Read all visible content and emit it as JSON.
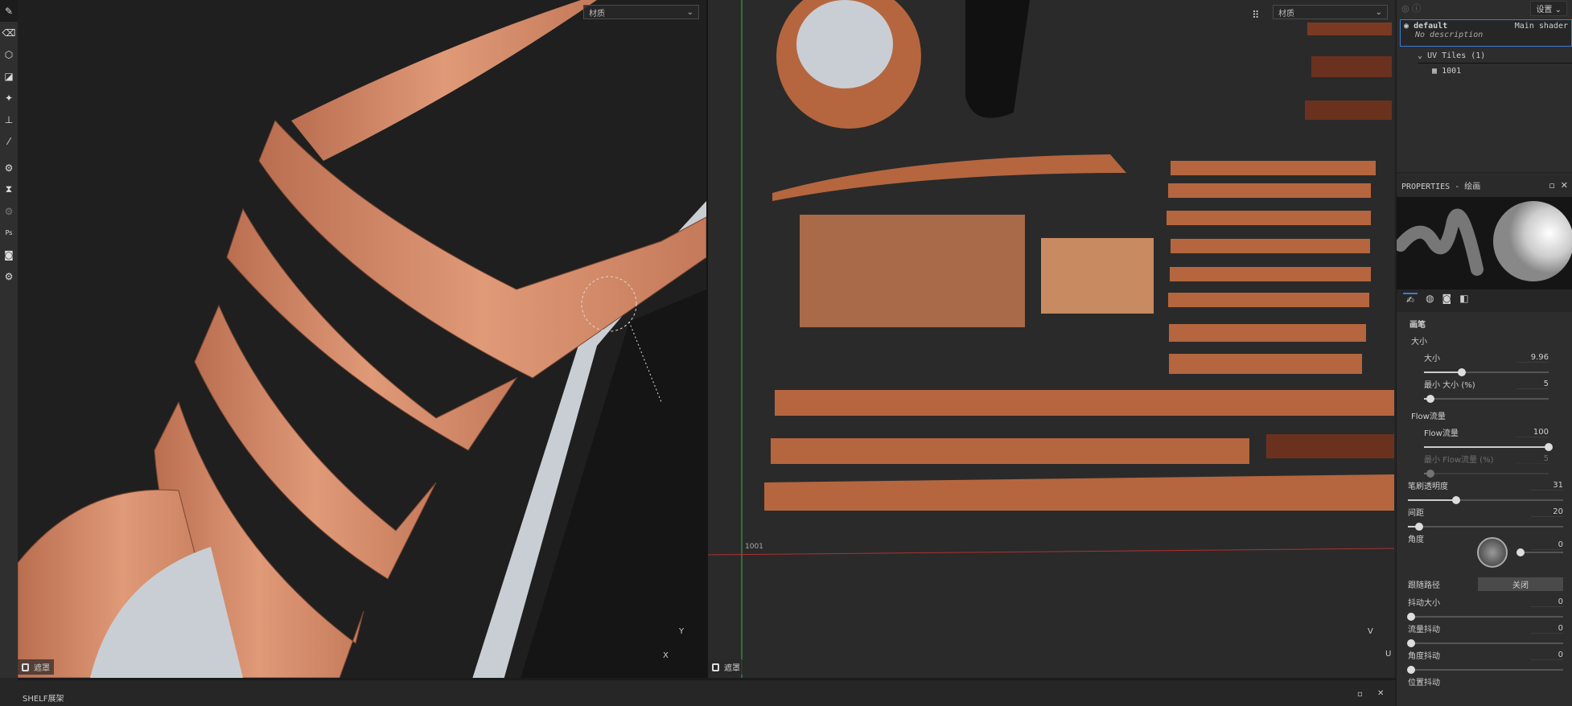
{
  "toolbar": {
    "tools": [
      "brush-icon",
      "eraser-icon",
      "projection-icon",
      "polygon-fill-icon",
      "smudge-icon",
      "clone-stamp-icon",
      "color-picker-icon",
      "plugin-icon",
      "hourglass-icon",
      "plugin2-icon",
      "photoshop-icon",
      "export-icon",
      "settings-icon"
    ]
  },
  "viewport3d": {
    "select_value": "材质",
    "mask_label": "遮罩",
    "axes": {
      "y": "Y",
      "x": "X"
    }
  },
  "viewportUV": {
    "select_value": "材质",
    "mask_label": "遮罩",
    "tile_label": "1001",
    "axes": {
      "v": "V",
      "u": "U"
    }
  },
  "shelf": {
    "title": "SHELF展架"
  },
  "texture_set": {
    "settings_label": "设置",
    "name": "default",
    "shader": "Main shader",
    "description": "No description",
    "uv_tiles_label": "UV Tiles (1)",
    "tile": "1001"
  },
  "properties": {
    "title": "PROPERTIES - 绘画",
    "section_brush": "画笔",
    "group_size": "大小",
    "size": {
      "label": "大小",
      "value": "9.96",
      "fraction": 0.3
    },
    "min_size": {
      "label": "最小 大小 (%)",
      "value": "5",
      "fraction": 0.05
    },
    "group_flow": "Flow流量",
    "flow": {
      "label": "Flow流量",
      "value": "100",
      "fraction": 1.0
    },
    "min_flow": {
      "label": "最小 Flow流量 (%)",
      "value": "5",
      "fraction": 0.05
    },
    "opacity": {
      "label": "笔刷透明度",
      "value": "31",
      "fraction": 0.31
    },
    "spacing": {
      "label": "间距",
      "value": "20",
      "fraction": 0.07
    },
    "angle": {
      "label": "角度",
      "value": "0"
    },
    "follow_path": {
      "label": "跟随路径",
      "value": "关闭"
    },
    "size_jitter": {
      "label": "抖动大小",
      "value": "0",
      "fraction": 0
    },
    "flow_jitter": {
      "label": "流量抖动",
      "value": "0",
      "fraction": 0
    },
    "angle_jitter": {
      "label": "角度抖动",
      "value": "0",
      "fraction": 0
    },
    "position_jitter": {
      "label": "位置抖动"
    }
  },
  "colors": {
    "accent": "#3a7bd5",
    "leather": "#d08a68",
    "copper": "#b5663f"
  }
}
